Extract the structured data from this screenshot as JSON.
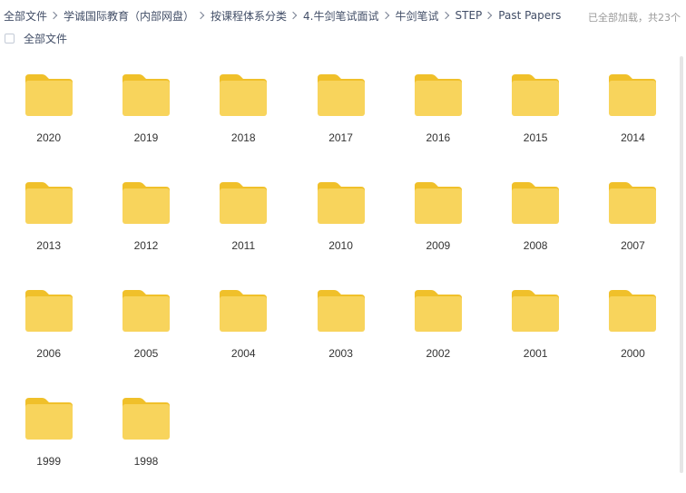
{
  "breadcrumb": [
    {
      "label": "全部文件"
    },
    {
      "label": "学诚国际教育（内部网盘）"
    },
    {
      "label": "按课程体系分类"
    },
    {
      "label": "4.牛剑笔试面试"
    },
    {
      "label": "牛剑笔试"
    },
    {
      "label": "STEP"
    },
    {
      "label": "Past Papers"
    }
  ],
  "load_status": "已全部加载，共23个",
  "select_all_label": "全部文件",
  "folder_icon": "folder-icon",
  "colors": {
    "folder_body": "#f8d45c",
    "folder_tab": "#f0c02a",
    "text": "#333333",
    "breadcrumb_text": "#424e67"
  },
  "folders": [
    {
      "name": "2020"
    },
    {
      "name": "2019"
    },
    {
      "name": "2018"
    },
    {
      "name": "2017"
    },
    {
      "name": "2016"
    },
    {
      "name": "2015"
    },
    {
      "name": "2014"
    },
    {
      "name": "2013"
    },
    {
      "name": "2012"
    },
    {
      "name": "2011"
    },
    {
      "name": "2010"
    },
    {
      "name": "2009"
    },
    {
      "name": "2008"
    },
    {
      "name": "2007"
    },
    {
      "name": "2006"
    },
    {
      "name": "2005"
    },
    {
      "name": "2004"
    },
    {
      "name": "2003"
    },
    {
      "name": "2002"
    },
    {
      "name": "2001"
    },
    {
      "name": "2000"
    },
    {
      "name": "1999"
    },
    {
      "name": "1998"
    }
  ]
}
